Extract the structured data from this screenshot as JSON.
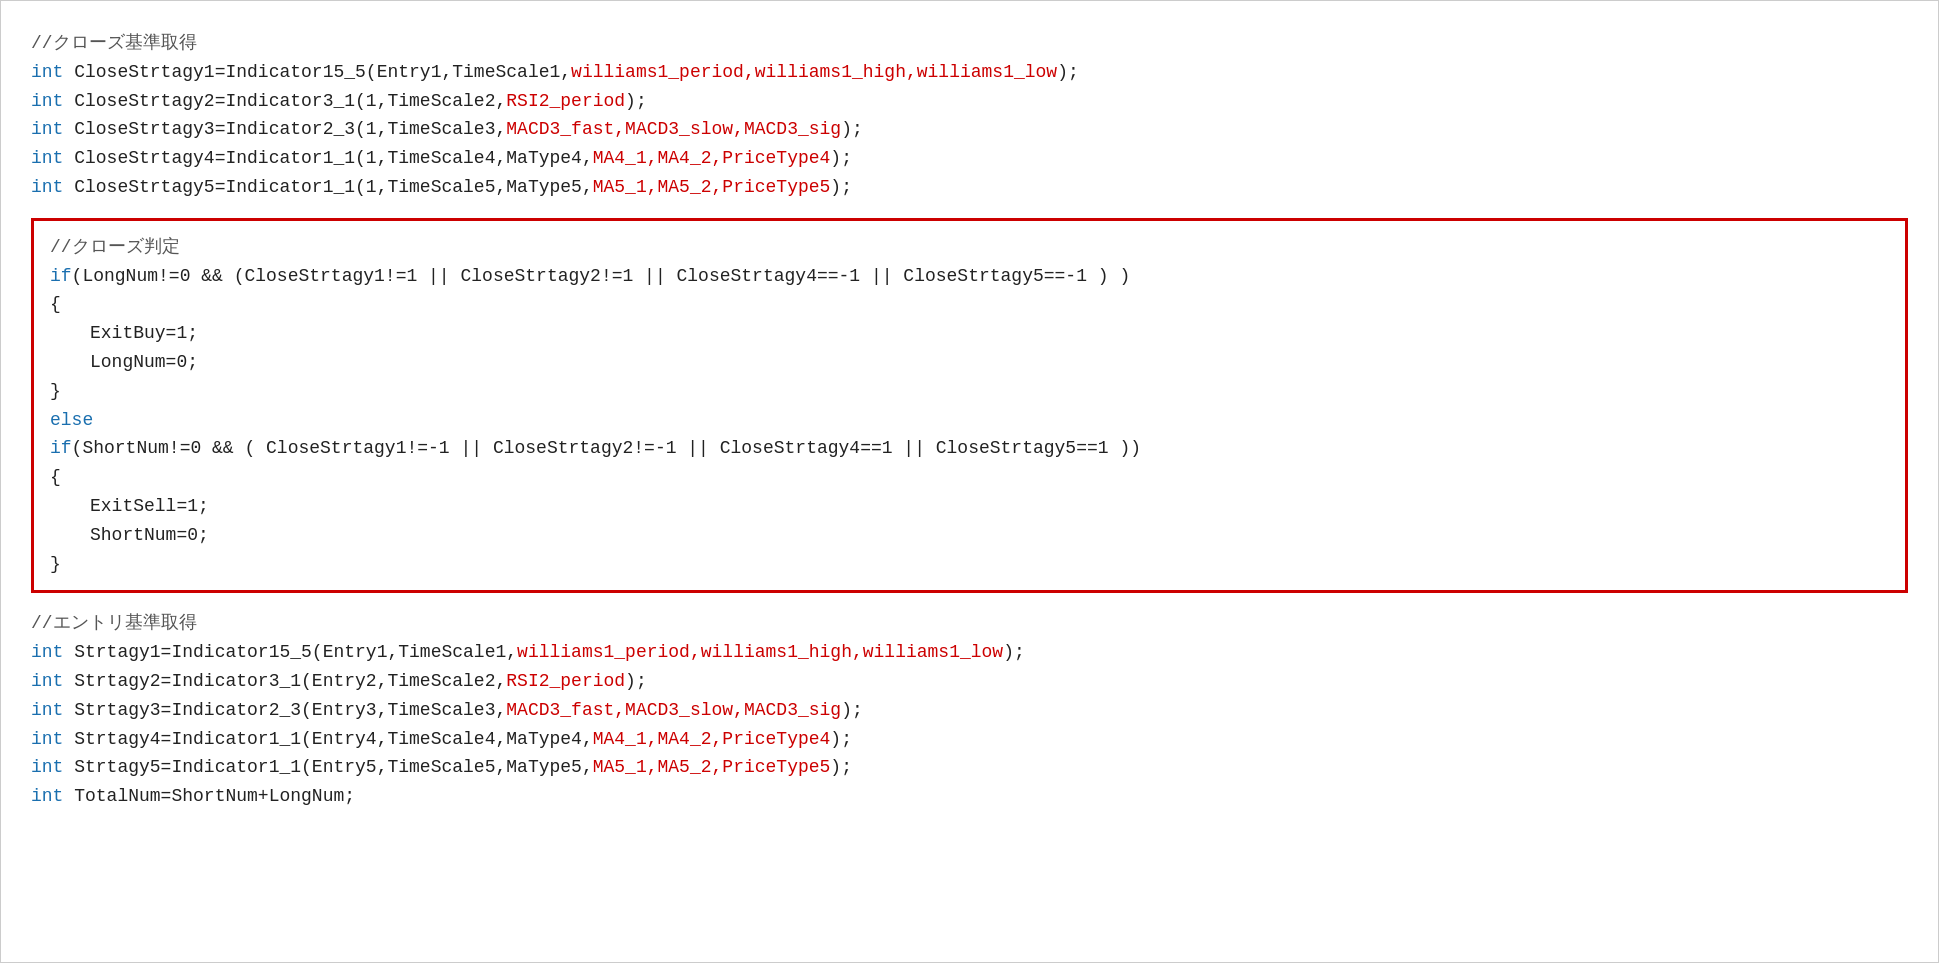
{
  "sections": {
    "close_get": {
      "comment": "//クローズ基準取得",
      "lines": [
        {
          "keyword": "int",
          "code": "CloseStrtagy1=Indicator15_5(Entry1,TimeScale1,",
          "params": "williams1_period,williams1_high,williams1_low",
          "suffix": ");"
        },
        {
          "keyword": "int",
          "code": "CloseStrtagy2=Indicator3_1(1,TimeScale2,",
          "params": "RSI2_period",
          "suffix": ");"
        },
        {
          "keyword": "int",
          "code": "CloseStrtagy3=Indicator2_3(1,TimeScale3,",
          "params": "MACD3_fast,MACD3_slow,MACD3_sig",
          "suffix": ");"
        },
        {
          "keyword": "int",
          "code": "CloseStrtagy4=Indicator1_1(1,TimeScale4,MaType4,",
          "params": "MA4_1,MA4_2,PriceType4",
          "suffix": ");"
        },
        {
          "keyword": "int",
          "code": "CloseStrtagy5=Indicator1_1(1,TimeScale5,MaType5,",
          "params": "MA5_1,MA5_2,PriceType5",
          "suffix": ");"
        }
      ]
    },
    "close_judge": {
      "comment": "//クローズ判定",
      "lines_raw": [
        "if(LongNum!=0 && (CloseStrtagy1!=1 || CloseStrtagy2!=1 || CloseStrtagy4==-1 || CloseStrtagy5==-1 ) )",
        "{",
        "    ExitBuy=1;",
        "    LongNum=0;",
        "}",
        "else",
        "if(ShortNum!=0 && ( CloseStrtagy1!=-1 || CloseStrtagy2!=-1 || CloseStrtagy4==1 || CloseStrtagy5==1 ))",
        "{",
        "    ExitSell=1;",
        "    ShortNum=0;",
        "}"
      ]
    },
    "entry_get": {
      "comment": "//エントリ基準取得",
      "lines": [
        {
          "keyword": "int",
          "code": "Strtagy1=Indicator15_5(Entry1,TimeScale1,",
          "params": "williams1_period,williams1_high,williams1_low",
          "suffix": ");"
        },
        {
          "keyword": "int",
          "code": "Strtagy2=Indicator3_1(Entry2,TimeScale2,",
          "params": "RSI2_period",
          "suffix": ");"
        },
        {
          "keyword": "int",
          "code": "Strtagy3=Indicator2_3(Entry3,TimeScale3,",
          "params": "MACD3_fast,MACD3_slow,MACD3_sig",
          "suffix": ");"
        },
        {
          "keyword": "int",
          "code": "Strtagy4=Indicator1_1(Entry4,TimeScale4,MaType4,",
          "params": "MA4_1,MA4_2,PriceType4",
          "suffix": ");"
        },
        {
          "keyword": "int",
          "code": "Strtagy5=Indicator1_1(Entry5,TimeScale5,MaType5,",
          "params": "MA5_1,MA5_2,PriceType5",
          "suffix": ");"
        },
        {
          "keyword": "int",
          "code": "TotalNum=ShortNum+LongNum;",
          "params": "",
          "suffix": ""
        }
      ]
    }
  }
}
